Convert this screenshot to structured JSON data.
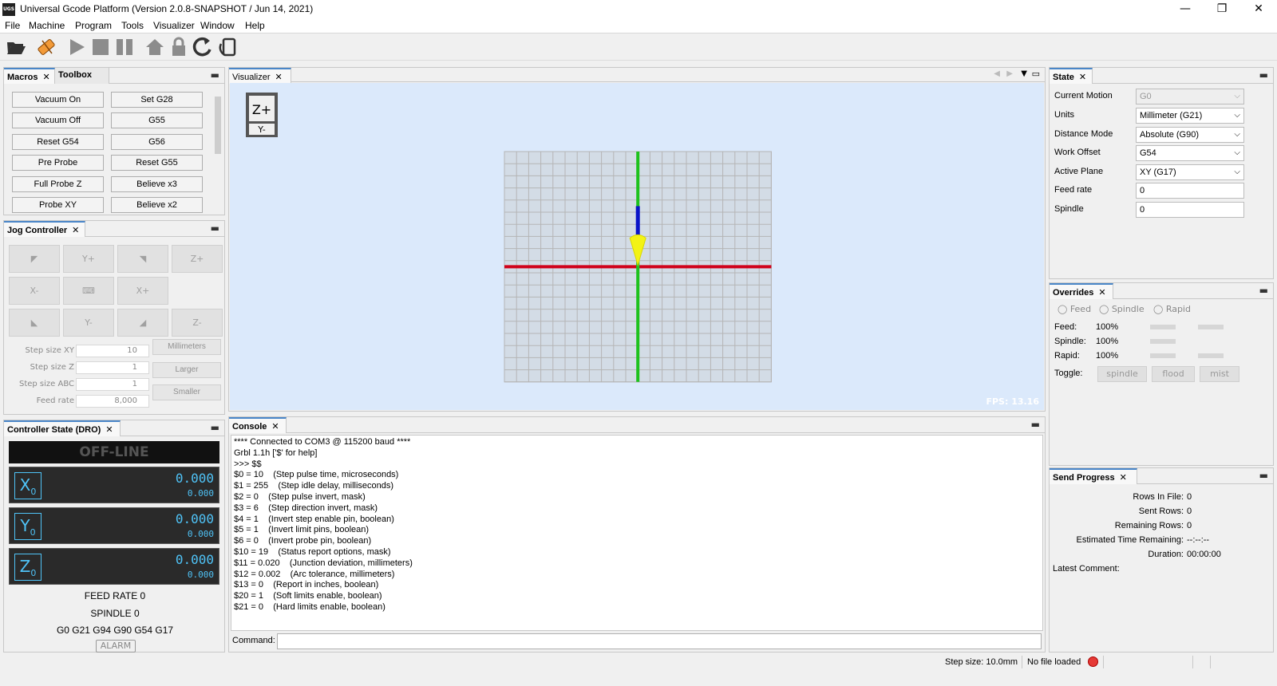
{
  "window": {
    "title": "Universal Gcode Platform (Version 2.0.8-SNAPSHOT / Jun 14, 2021)",
    "logo_text": "UGS",
    "minimize": "—",
    "maximize": "❐",
    "close": "✕"
  },
  "menu": [
    "File",
    "Machine",
    "Program",
    "Tools",
    "Visualizer",
    "Window",
    "Help"
  ],
  "macros_panel": {
    "tabs": [
      "Macros",
      "Toolbox"
    ],
    "buttons": [
      [
        "Vacuum On",
        "Set G28"
      ],
      [
        "Vacuum Off",
        "G55"
      ],
      [
        "Reset G54",
        "G56"
      ],
      [
        "Pre Probe",
        "Reset G55"
      ],
      [
        "Full Probe Z",
        "Believe x3"
      ],
      [
        "Probe XY",
        "Believe x2"
      ]
    ]
  },
  "jog_panel": {
    "title": "Jog Controller",
    "buttons": [
      "◤",
      "Y+",
      "◥",
      "Z+",
      "X-",
      "⌨",
      "X+",
      "◣",
      "Y-",
      "◢",
      "Z-"
    ],
    "step_xy_label": "Step size XY",
    "step_xy": "10",
    "step_z_label": "Step size Z",
    "step_z": "1",
    "step_abc_label": "Step size ABC",
    "step_abc": "1",
    "feed_label": "Feed rate",
    "feed": "8,000",
    "units_btn": "Millimeters",
    "larger_btn": "Larger",
    "smaller_btn": "Smaller"
  },
  "dro_panel": {
    "title": "Controller State (DRO)",
    "status": "OFF-LINE",
    "axes": [
      {
        "axis": "X",
        "sub": "0",
        "work": "0.000",
        "machine": "0.000"
      },
      {
        "axis": "Y",
        "sub": "0",
        "work": "0.000",
        "machine": "0.000"
      },
      {
        "axis": "Z",
        "sub": "0",
        "work": "0.000",
        "machine": "0.000"
      }
    ],
    "feed_rate": "FEED RATE 0",
    "spindle": "SPINDLE 0",
    "gcodes": "G0 G21 G94 G90 G54 G17",
    "alarm": "ALARM"
  },
  "visualizer": {
    "tab": "Visualizer",
    "cube_top": "Z+",
    "cube_front": "Y-",
    "fps": "FPS: 13.16",
    "colors": {
      "bg": "#dbe9fb",
      "grid": "#b5b5b5",
      "x_axis": "#d0021b",
      "y_axis": "#1ec21e",
      "z_axis": "#0a14c8",
      "tool": "#f3f315"
    }
  },
  "console": {
    "tab": "Console",
    "lines": [
      "**** Connected to COM3 @ 115200 baud ****",
      "Grbl 1.1h ['$' for help]",
      ">>> $$",
      "$0 = 10    (Step pulse time, microseconds)",
      "$1 = 255    (Step idle delay, milliseconds)",
      "$2 = 0    (Step pulse invert, mask)",
      "$3 = 6    (Step direction invert, mask)",
      "$4 = 1    (Invert step enable pin, boolean)",
      "$5 = 1    (Invert limit pins, boolean)",
      "$6 = 0    (Invert probe pin, boolean)",
      "$10 = 19    (Status report options, mask)",
      "$11 = 0.020    (Junction deviation, millimeters)",
      "$12 = 0.002    (Arc tolerance, millimeters)",
      "$13 = 0    (Report in inches, boolean)",
      "$20 = 1    (Soft limits enable, boolean)",
      "$21 = 0    (Hard limits enable, boolean)"
    ],
    "command_label": "Command:"
  },
  "state_panel": {
    "title": "State",
    "rows": [
      {
        "label": "Current Motion",
        "value": "G0",
        "type": "combo-disabled"
      },
      {
        "label": "Units",
        "value": "Millimeter (G21)",
        "type": "combo"
      },
      {
        "label": "Distance Mode",
        "value": "Absolute (G90)",
        "type": "combo"
      },
      {
        "label": "Work Offset",
        "value": "G54",
        "type": "combo"
      },
      {
        "label": "Active Plane",
        "value": "XY (G17)",
        "type": "combo"
      },
      {
        "label": "Feed rate",
        "value": "0",
        "type": "text"
      },
      {
        "label": "Spindle",
        "value": "0",
        "type": "text"
      }
    ]
  },
  "overrides_panel": {
    "title": "Overrides",
    "radios": [
      "Feed",
      "Spindle",
      "Rapid"
    ],
    "feed_label": "Feed:",
    "feed": "100%",
    "spindle_label": "Spindle:",
    "spindle": "100%",
    "rapid_label": "Rapid:",
    "rapid": "100%",
    "toggle_label": "Toggle:",
    "toggles": [
      "spindle",
      "flood",
      "mist"
    ]
  },
  "progress_panel": {
    "title": "Send Progress",
    "rows_in_file_label": "Rows In File:",
    "rows_in_file": "0",
    "sent_rows_label": "Sent Rows:",
    "sent_rows": "0",
    "remaining_rows_label": "Remaining Rows:",
    "remaining_rows": "0",
    "est_time_label": "Estimated Time Remaining:",
    "est_time": "--:--:--",
    "duration_label": "Duration:",
    "duration": "00:00:00",
    "latest_comment_label": "Latest Comment:"
  },
  "statusbar": {
    "step_size": "Step size: 10.0mm",
    "file": "No file loaded"
  }
}
